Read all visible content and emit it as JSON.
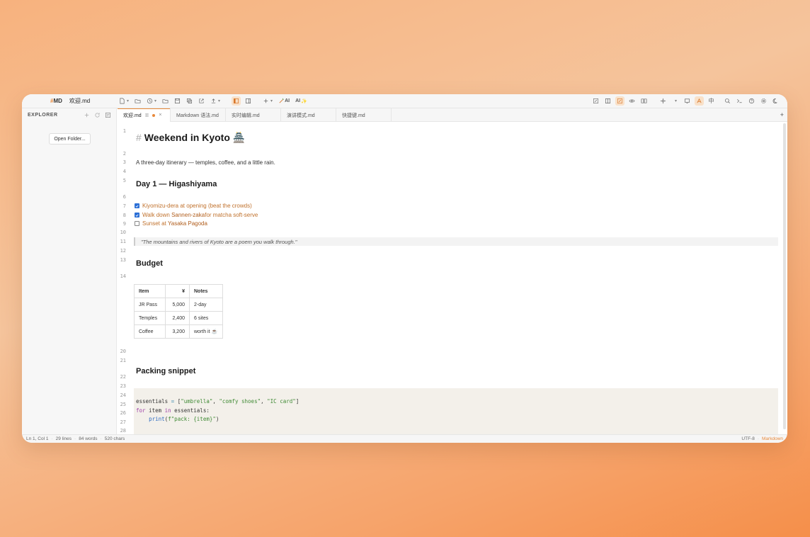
{
  "app": {
    "logo_hash": "#",
    "logo_text": "MD",
    "filename": "欢迎.md"
  },
  "toolbar": {
    "ai_label": "AI",
    "ai_label2": "AI",
    "lang_label": "中"
  },
  "sidebar": {
    "title": "EXPLORER",
    "open_folder": "Open Folder..."
  },
  "tabs": [
    {
      "label": "欢迎.md",
      "active": true
    },
    {
      "label": "Markdown 语法.md"
    },
    {
      "label": "实时编辑.md"
    },
    {
      "label": "演讲模式.md"
    },
    {
      "label": "快捷键.md"
    }
  ],
  "editor": {
    "line_numbers": [
      "1",
      "2",
      "3",
      "4",
      "5",
      "6",
      "7",
      "8",
      "9",
      "10",
      "11",
      "12",
      "13",
      "14",
      "20",
      "21",
      "22",
      "23",
      "24",
      "25",
      "26",
      "27",
      "28"
    ],
    "h1_mark": "#",
    "h1": "Weekend in Kyoto 🏯",
    "intro": "A three-day itinerary — temples, coffee, and a little rain.",
    "day1": "Day 1 — Higashiyama",
    "tasks": [
      {
        "pre": "Kiyomizu-dera at opening (beat the crowds)",
        "bold": "",
        "post": "",
        "done": true
      },
      {
        "pre": "Walk down ",
        "bold": "Sannen-zaka",
        "post": " for matcha soft-serve",
        "done": true
      },
      {
        "pre": "Sunset at ",
        "bold": "Yasaka Pagoda",
        "post": "",
        "done": false
      }
    ],
    "quote": "\"The mountains and rivers of Kyoto are a poem you walk through.\"",
    "budget_title": "Budget",
    "table": {
      "headers": [
        "Item",
        "¥",
        "Notes"
      ],
      "rows": [
        [
          "JR Pass",
          "5,000",
          "2-day"
        ],
        [
          "Temples",
          "2,400",
          "6 sites"
        ],
        [
          "Coffee",
          "3,200",
          "worth it ☕"
        ]
      ]
    },
    "packing_title": "Packing snippet",
    "code": {
      "l1_var": "essentials",
      "l1_eq": " = ",
      "l1_open": "[",
      "l1_s1": "\"umbrella\"",
      "l1_c1": ", ",
      "l1_s2": "\"comfy shoes\"",
      "l1_c2": ", ",
      "l1_s3": "\"IC card\"",
      "l1_close": "]",
      "l2_for": "for",
      "l2_mid": " item ",
      "l2_in": "in",
      "l2_end": " essentials:",
      "l3_indent": "    ",
      "l3_fn": "print",
      "l3_open": "(",
      "l3_str": "f\"pack: {item}\"",
      "l3_close": ")"
    }
  },
  "status": {
    "position": "Ln 1, Col 1",
    "lines": "29 lines",
    "words": "84 words",
    "chars": "520 chars",
    "encoding": "UTF-8",
    "mode": "Markdown"
  }
}
